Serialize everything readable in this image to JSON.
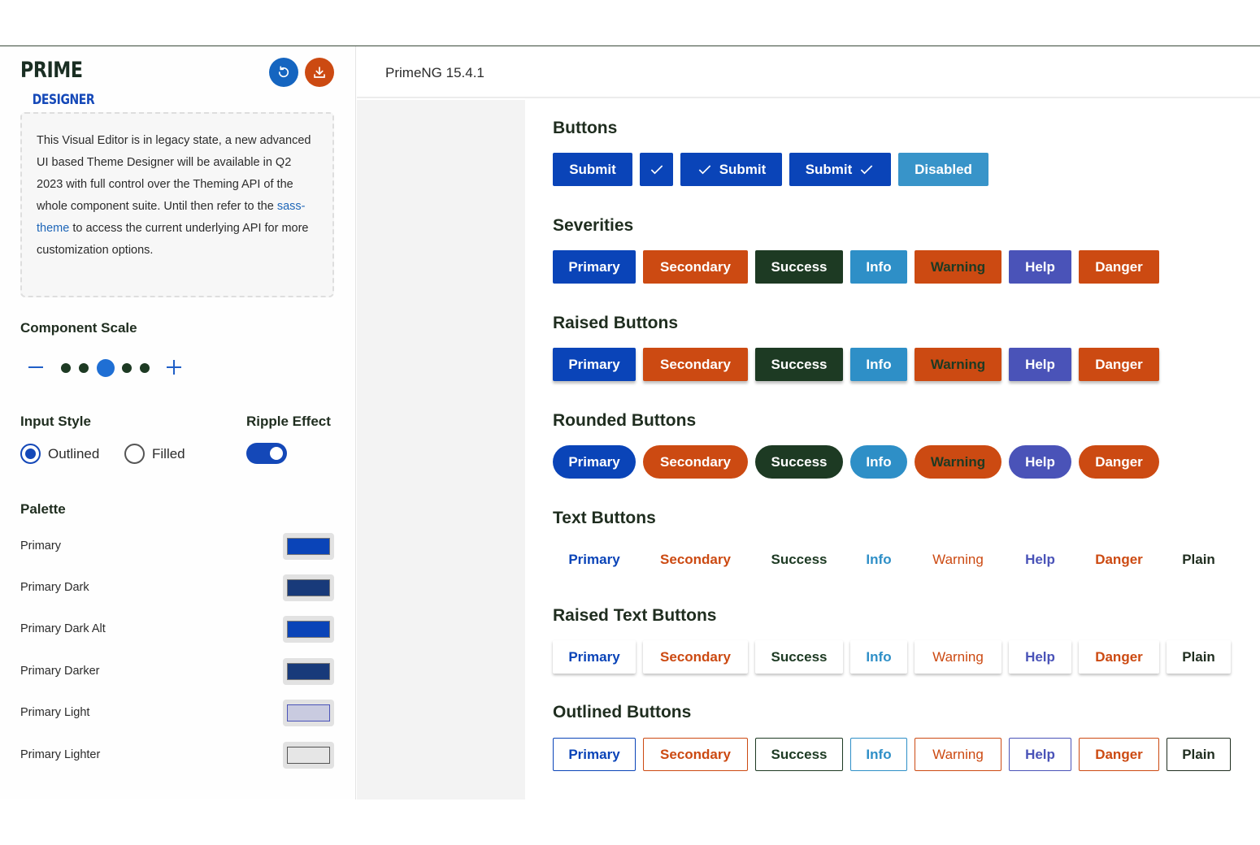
{
  "sidebar": {
    "logo_part1": "PRIME",
    "logo_part2": "DESIGNER",
    "refresh_icon": "refresh-icon",
    "download_icon": "download-icon",
    "notice": {
      "text1": "This Visual Editor is in legacy state, a new advanced UI based Theme Designer will be available in Q2 2023 with full control over the Theming API of the whole component suite. Until then refer to the ",
      "link": "sass-theme",
      "text2": " to access the current underlying API for more customization options."
    },
    "component_scale_label": "Component Scale",
    "scale_selected_index": 2,
    "input_style_label": "Input Style",
    "input_style_options": [
      "Outlined",
      "Filled"
    ],
    "input_style_selected": "Outlined",
    "ripple_label": "Ripple Effect",
    "ripple_on": true,
    "palette_label": "Palette",
    "palette": [
      {
        "label": "Primary",
        "color": "#0a44b8"
      },
      {
        "label": "Primary Dark",
        "color": "#183a7a"
      },
      {
        "label": "Primary Dark Alt",
        "color": "#0a44b8"
      },
      {
        "label": "Primary Darker",
        "color": "#183a7a"
      },
      {
        "label": "Primary Light",
        "color": "#c9cbe0"
      },
      {
        "label": "Primary Lighter",
        "color": "#e6e6e6"
      }
    ]
  },
  "header": {
    "version": "PrimeNG 15.4.1"
  },
  "sections": {
    "buttons": {
      "title": "Buttons",
      "submit": "Submit",
      "disabled": "Disabled"
    },
    "severities": {
      "title": "Severities"
    },
    "raised": {
      "title": "Raised Buttons"
    },
    "rounded": {
      "title": "Rounded Buttons"
    },
    "text": {
      "title": "Text Buttons"
    },
    "raised_text": {
      "title": "Raised Text Buttons"
    },
    "outlined": {
      "title": "Outlined Buttons"
    }
  },
  "labels": {
    "primary": "Primary",
    "secondary": "Secondary",
    "success": "Success",
    "info": "Info",
    "warning": "Warning",
    "help": "Help",
    "danger": "Danger",
    "plain": "Plain"
  },
  "colors": {
    "primary": "#0a44b8",
    "secondary": "#cc4a12",
    "success": "#1d3a23",
    "info": "#2e8fc7",
    "help": "#4a53b8"
  }
}
